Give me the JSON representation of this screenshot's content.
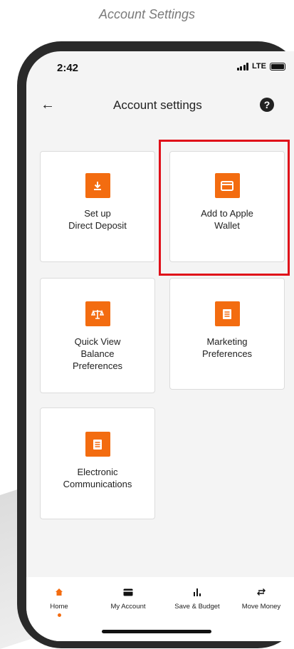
{
  "caption": "Account Settings",
  "status_bar": {
    "time": "2:42",
    "network": "LTE"
  },
  "header": {
    "title": "Account settings",
    "help_glyph": "?"
  },
  "cards": [
    {
      "label": "Set up\nDirect Deposit",
      "icon": "download-icon"
    },
    {
      "label": "Add to Apple\nWallet",
      "icon": "card-icon"
    },
    {
      "label": "Quick View\nBalance\nPreferences",
      "icon": "scale-icon"
    },
    {
      "label": "Marketing\nPreferences",
      "icon": "document-icon"
    },
    {
      "label": "Electronic\nCommunications",
      "icon": "document-icon"
    }
  ],
  "bottom_nav": [
    {
      "label": "Home",
      "icon": "home-icon",
      "active": true
    },
    {
      "label": "My Account",
      "icon": "card-icon"
    },
    {
      "label": "Save & Budget",
      "icon": "bar-chart-icon"
    },
    {
      "label": "Move Money",
      "icon": "transfer-icon"
    }
  ],
  "colors": {
    "accent": "#f36c10",
    "highlight": "#e0101a",
    "frame": "#2a2a2a"
  }
}
